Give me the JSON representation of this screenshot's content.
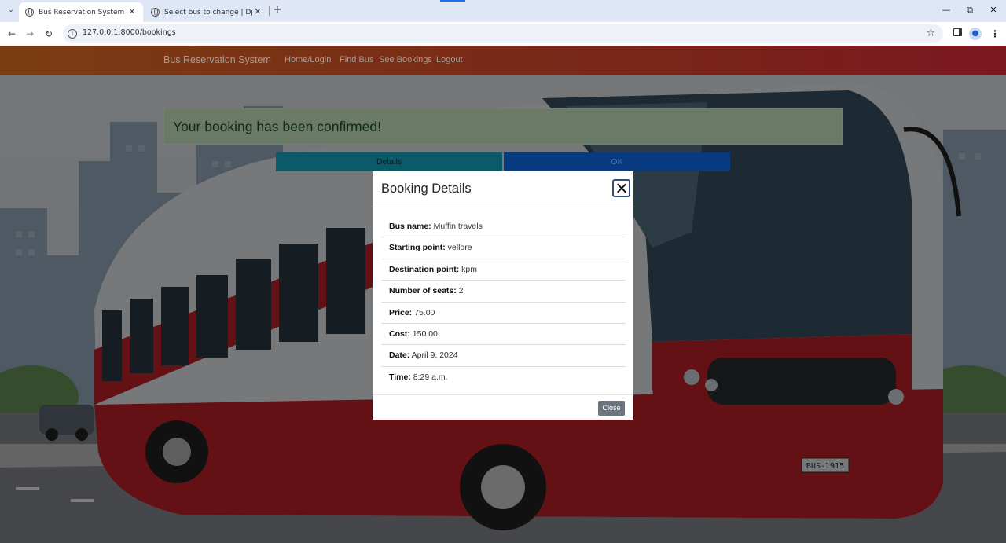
{
  "browser": {
    "tabs": [
      {
        "title": "Bus Reservation System in Djan",
        "active": true
      },
      {
        "title": "Select bus to change | Django s",
        "active": false
      }
    ],
    "url": "127.0.0.1:8000/bookings"
  },
  "navbar": {
    "brand": "Bus Reservation System",
    "links": [
      "Home/Login",
      "Find Bus",
      "See Bookings",
      "Logout"
    ]
  },
  "alert": {
    "message": "Your booking has been confirmed!"
  },
  "actions": {
    "details_label": "Details",
    "ok_label": "OK"
  },
  "modal": {
    "title": "Booking Details",
    "items": [
      {
        "label": "Bus name:",
        "value": "Muffin travels"
      },
      {
        "label": "Starting point:",
        "value": "vellore"
      },
      {
        "label": "Destination point:",
        "value": "kpm"
      },
      {
        "label": "Number of seats:",
        "value": "2"
      },
      {
        "label": "Price:",
        "value": "75.00"
      },
      {
        "label": "Cost:",
        "value": "150.00"
      },
      {
        "label": "Date:",
        "value": "April 9, 2024"
      },
      {
        "label": "Time:",
        "value": "8:29 a.m."
      }
    ],
    "close_label": "Close"
  },
  "bus": {
    "plate": "BUS-1915"
  },
  "colors": {
    "navbar_start": "#7a3d13",
    "navbar_end": "#7a1820",
    "details_button": "#0a5a6a",
    "ok_button": "#083a80",
    "close_button": "#6c757d",
    "bus_red": "#c9232a"
  }
}
